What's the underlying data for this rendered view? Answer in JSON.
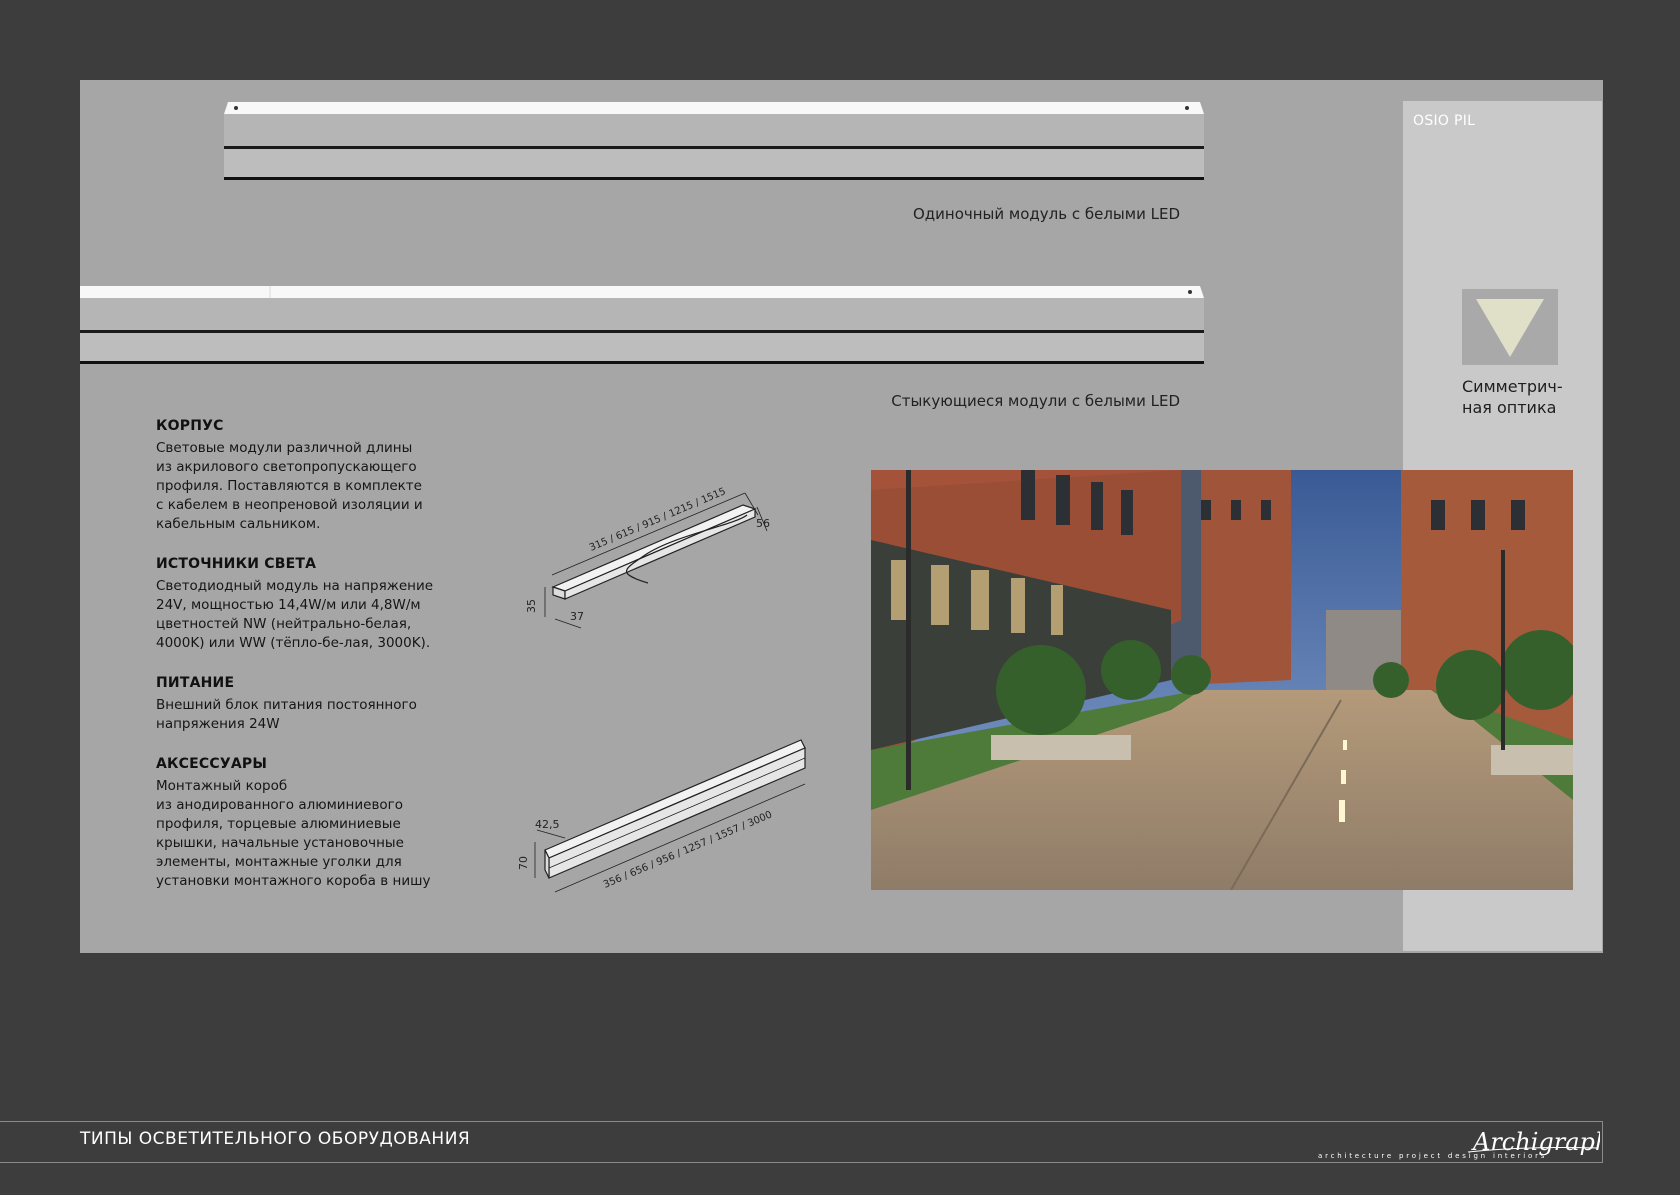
{
  "header": {
    "series_name": "OSIO PIL"
  },
  "modules": {
    "single_caption": "Одиночный модуль с белыми LED",
    "joined_caption": "Стыкующиеся модули с белыми LED"
  },
  "optics": {
    "label": "Симметрич-\nная оптика"
  },
  "sections": [
    {
      "title": "КОРПУС",
      "text": "Световые модули различной длины\nиз акрилового светопропускающего\nпрофиля. Поставляются в комплекте\nс кабелем в неопреновой изоляции и\nкабельным сальником."
    },
    {
      "title": "ИСТОЧНИКИ СВЕТА",
      "text": "Светодиодный модуль на напряжение\n24V, мощностью 14,4W/м или 4,8W/м\nцветностей NW (нейтрально-белая,\n4000K) или WW (тёпло-бе-лая, 3000K)."
    },
    {
      "title": "ПИТАНИЕ",
      "text": "Внешний блок питания постоянного\nнапряжения 24W"
    },
    {
      "title": "АКСЕССУАРЫ",
      "text": "Монтажный короб\nиз анодированного алюминиевого\nпрофиля, торцевые алюминиевые\nкрышки, начальные установочные\nэлементы, монтажные уголки для\nустановки монтажного короба в нишу"
    }
  ],
  "drawings": {
    "module": {
      "lengths": "315 / 615 / 915 / 1215 / 1515",
      "width": "56",
      "height": "35",
      "depth": "37"
    },
    "box": {
      "lengths": "356 / 656 / 956 / 1257 / 1557 / 3000",
      "width": "42,5",
      "height": "70"
    }
  },
  "footer": {
    "title": "ТИПЫ ОСВЕТИТЕЛЬНОГО ОБОРУДОВАНИЯ",
    "logo_text": "Archigraph",
    "tagline": "architecture project design interiors"
  },
  "colors": {
    "background": "#3d3d3d",
    "panel": "#a6a6a6",
    "sidebar": "#c9c9c9",
    "triangle": "#e0dfc8"
  }
}
